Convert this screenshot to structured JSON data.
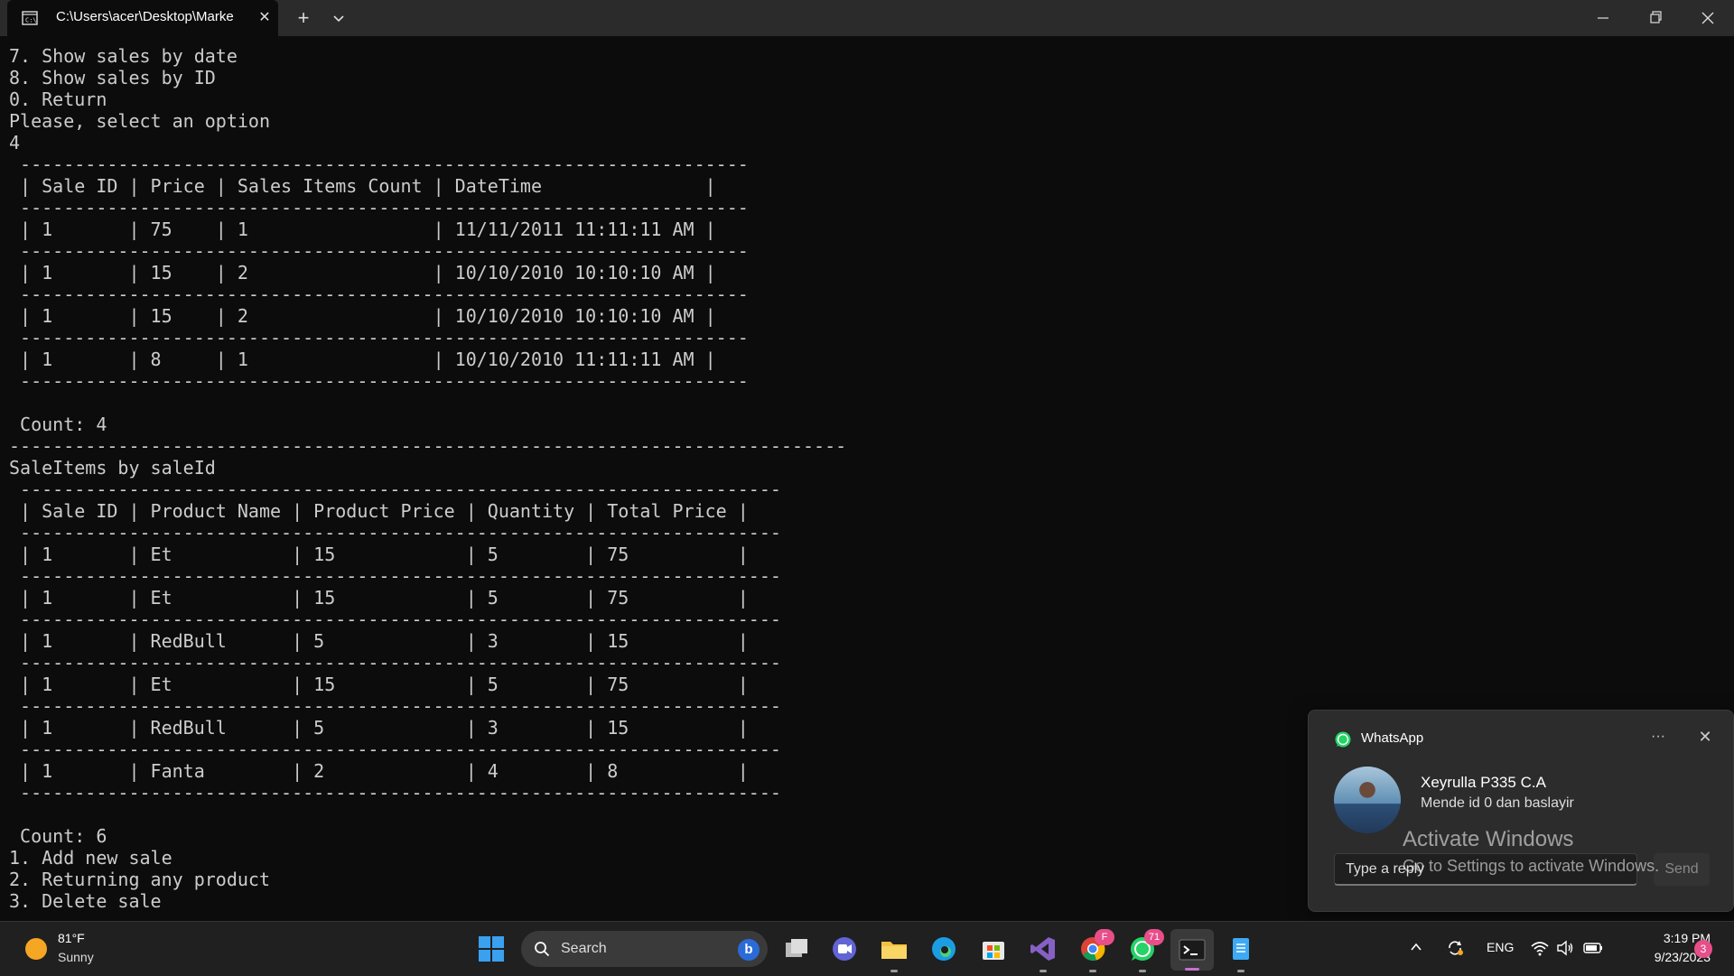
{
  "window": {
    "tab_title": "C:\\Users\\acer\\Desktop\\Marke",
    "new_tab_label": "+",
    "tab_close_label": "✕"
  },
  "console": {
    "text": "7. Show sales by date\n8. Show sales by ID\n0. Return\nPlease, select an option\n4\n -------------------------------------------------------------------\n | Sale ID | Price | Sales Items Count | DateTime               |\n -------------------------------------------------------------------\n | 1       | 75    | 1                 | 11/11/2011 11:11:11 AM |\n -------------------------------------------------------------------\n | 1       | 15    | 2                 | 10/10/2010 10:10:10 AM |\n -------------------------------------------------------------------\n | 1       | 15    | 2                 | 10/10/2010 10:10:10 AM |\n -------------------------------------------------------------------\n | 1       | 8     | 1                 | 10/10/2010 11:11:11 AM |\n -------------------------------------------------------------------\n\n Count: 4\n-----------------------------------------------------------------------------\nSaleItems by saleId\n ----------------------------------------------------------------------\n | Sale ID | Product Name | Product Price | Quantity | Total Price |\n ----------------------------------------------------------------------\n | 1       | Et           | 15            | 5        | 75          |\n ----------------------------------------------------------------------\n | 1       | Et           | 15            | 5        | 75          |\n ----------------------------------------------------------------------\n | 1       | RedBull      | 5             | 3        | 15          |\n ----------------------------------------------------------------------\n | 1       | Et           | 15            | 5        | 75          |\n ----------------------------------------------------------------------\n | 1       | RedBull      | 5             | 3        | 15          |\n ----------------------------------------------------------------------\n | 1       | Fanta        | 2             | 4        | 8           |\n ----------------------------------------------------------------------\n\n Count: 6\n1. Add new sale\n2. Returning any product\n3. Delete sale"
  },
  "notification": {
    "app_name": "WhatsApp",
    "more_label": "···",
    "close_label": "✕",
    "sender": "Xeyrulla P335 C.A",
    "message": "Mende id 0 dan baslayir",
    "reply_placeholder": "Type a reply",
    "send_label": "Send"
  },
  "watermark": {
    "title": "Activate Windows",
    "subtitle": "Go to Settings to activate Windows."
  },
  "taskbar": {
    "weather_temp": "81°F",
    "weather_condition": "Sunny",
    "search_label": "Search",
    "bing_label": "b",
    "chrome_badge": "F",
    "whatsapp_badge": "71",
    "language": "ENG",
    "time": "3:19 PM",
    "date": "9/23/2023",
    "notification_count": "3"
  }
}
